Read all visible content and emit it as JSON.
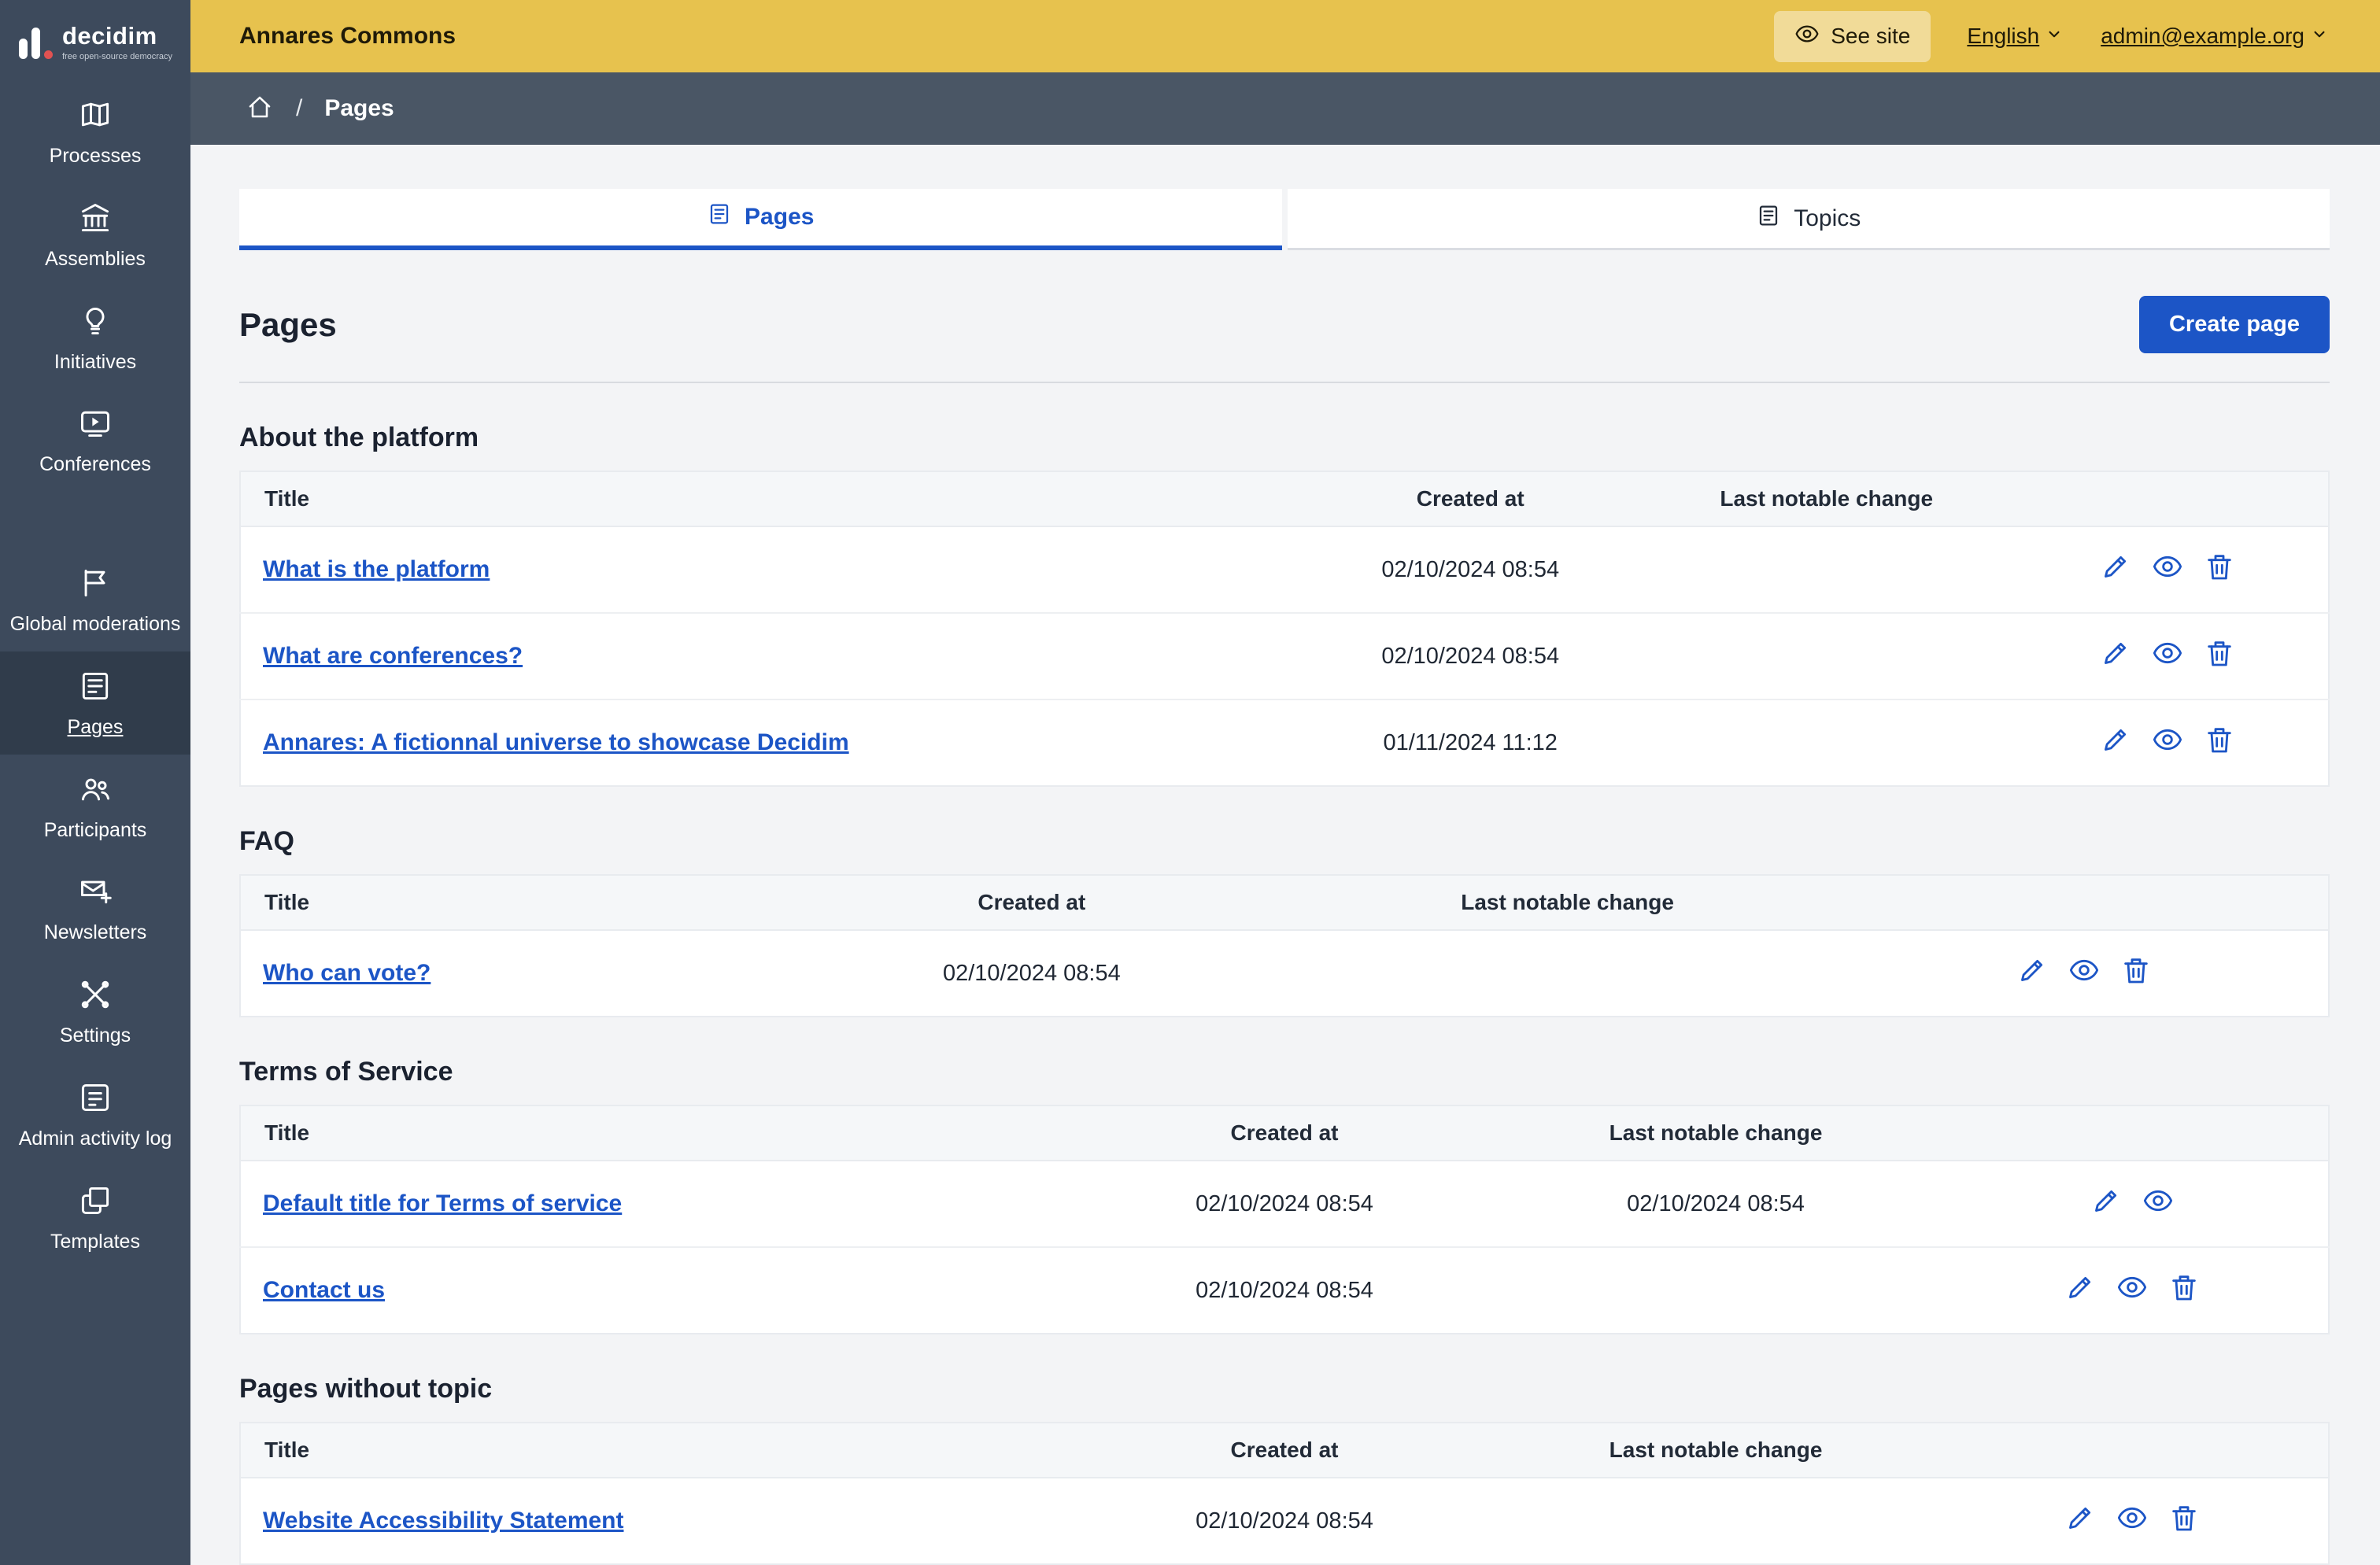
{
  "topbar": {
    "org_name": "Annares Commons",
    "see_site_label": "See site",
    "language_label": "English",
    "account_label": "admin@example.org"
  },
  "sidebar": {
    "logo_text": "decidim",
    "logo_tagline": "free open-source democracy",
    "items": [
      {
        "label": "Processes",
        "icon": "map-icon",
        "active": false
      },
      {
        "label": "Assemblies",
        "icon": "government-icon",
        "active": false
      },
      {
        "label": "Initiatives",
        "icon": "lightbulb-icon",
        "active": false
      },
      {
        "label": "Conferences",
        "icon": "video-icon",
        "active": false
      },
      {
        "label": "Global moderations",
        "icon": "flag-icon",
        "active": false
      },
      {
        "label": "Pages",
        "icon": "pages-icon",
        "active": true
      },
      {
        "label": "Participants",
        "icon": "team-icon",
        "active": false
      },
      {
        "label": "Newsletters",
        "icon": "mail-add-icon",
        "active": false
      },
      {
        "label": "Settings",
        "icon": "tools-icon",
        "active": false
      },
      {
        "label": "Admin activity log",
        "icon": "activity-log-icon",
        "active": false
      },
      {
        "label": "Templates",
        "icon": "copy-icon",
        "active": false
      }
    ]
  },
  "breadcrumb": {
    "current": "Pages"
  },
  "main": {
    "tabs": [
      {
        "label": "Pages",
        "active": true
      },
      {
        "label": "Topics",
        "active": false
      }
    ],
    "title": "Pages",
    "create_button": "Create page",
    "table_headers": {
      "title": "Title",
      "created_at": "Created at",
      "last_change": "Last notable change"
    },
    "sections": [
      {
        "heading": "About the platform",
        "rows": [
          {
            "title": "What is the platform",
            "created_at": "02/10/2024 08:54",
            "last_change": "",
            "actions": [
              "edit",
              "preview",
              "delete"
            ]
          },
          {
            "title": "What are conferences?",
            "created_at": "02/10/2024 08:54",
            "last_change": "",
            "actions": [
              "edit",
              "preview",
              "delete"
            ]
          },
          {
            "title": "Annares: A fictionnal universe to showcase Decidim",
            "created_at": "01/11/2024 11:12",
            "last_change": "",
            "actions": [
              "edit",
              "preview",
              "delete"
            ]
          }
        ]
      },
      {
        "heading": "FAQ",
        "rows": [
          {
            "title": "Who can vote?",
            "created_at": "02/10/2024 08:54",
            "last_change": "",
            "actions": [
              "edit",
              "preview",
              "delete"
            ]
          }
        ]
      },
      {
        "heading": "Terms of Service",
        "rows": [
          {
            "title": "Default title for Terms of service",
            "created_at": "02/10/2024 08:54",
            "last_change": "02/10/2024 08:54",
            "actions": [
              "edit",
              "preview"
            ]
          },
          {
            "title": "Contact us",
            "created_at": "02/10/2024 08:54",
            "last_change": "",
            "actions": [
              "edit",
              "preview",
              "delete"
            ]
          }
        ]
      },
      {
        "heading": "Pages without topic",
        "rows": [
          {
            "title": "Website Accessibility Statement",
            "created_at": "02/10/2024 08:54",
            "last_change": "",
            "actions": [
              "edit",
              "preview",
              "delete"
            ]
          }
        ]
      }
    ]
  },
  "colors": {
    "accent_blue": "#1c55c6",
    "topbar_yellow": "#e7c24e",
    "sidebar_dark": "#3d4a5c",
    "page_background": "#f3f4f6"
  }
}
